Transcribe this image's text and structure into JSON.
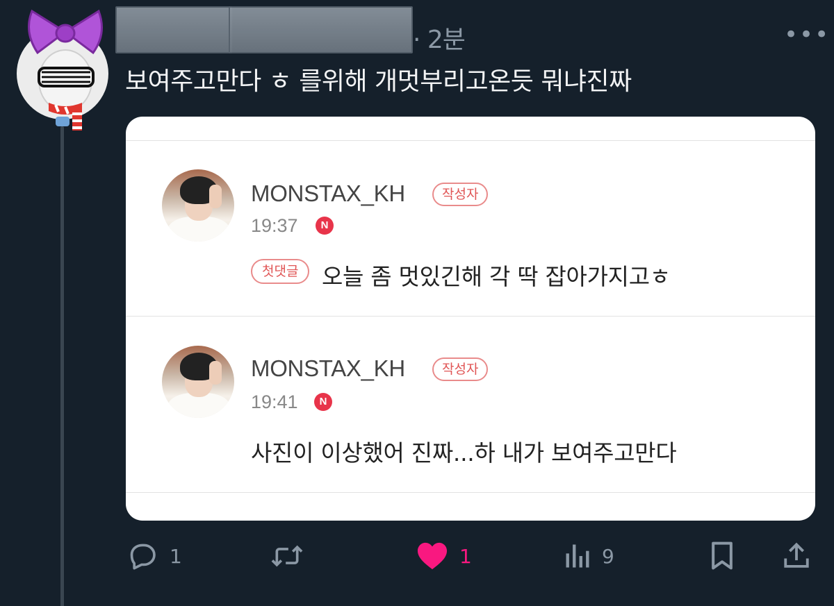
{
  "header": {
    "time": "· 2분",
    "more": "•••"
  },
  "tweet": {
    "text": "보여주고만다 ㅎ 를위해 개멋부리고온듯 뭐냐진짜"
  },
  "card": {
    "comments": [
      {
        "author": "MONSTAX_KH",
        "author_tag": "작성자",
        "time": "19:37",
        "badge": "N",
        "first_tag": "첫댓글",
        "text": "오늘 좀 멋있긴해 각 딱 잡아가지고ㅎ"
      },
      {
        "author": "MONSTAX_KH",
        "author_tag": "작성자",
        "time": "19:41",
        "badge": "N",
        "text": "사진이 이상했어 진짜...하 내가 보여주고만다"
      }
    ]
  },
  "actions": {
    "reply": {
      "icon": "reply-icon",
      "count": "1"
    },
    "retweet": {
      "icon": "retweet-icon",
      "count": ""
    },
    "like": {
      "icon": "heart-icon",
      "count": "1",
      "color": "#f91880"
    },
    "views": {
      "icon": "views-icon",
      "count": "9"
    },
    "bookmark": {
      "icon": "bookmark-icon"
    },
    "share": {
      "icon": "share-icon"
    }
  },
  "colors": {
    "background": "#15202b",
    "muted": "#8b98a5",
    "accent_red": "#e8344a"
  }
}
